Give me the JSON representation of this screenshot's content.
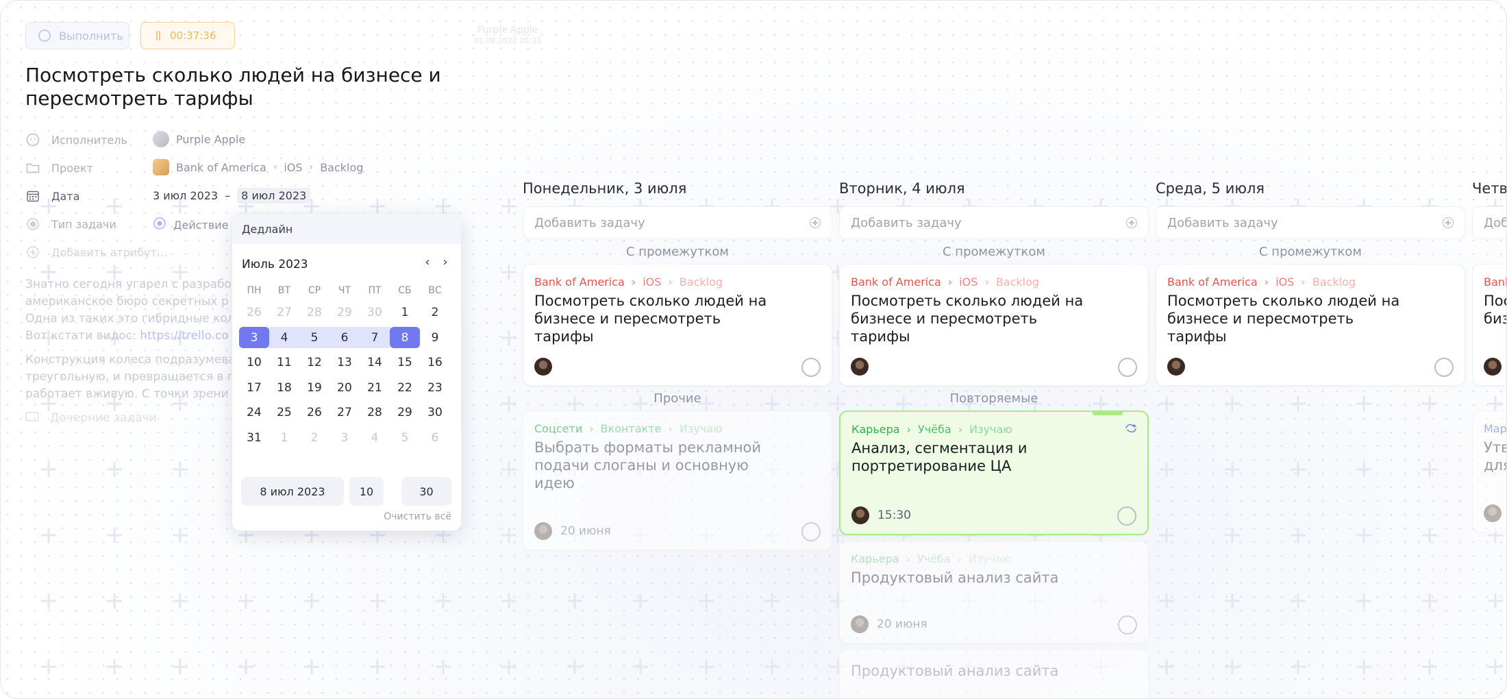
{
  "toolbar": {
    "complete_label": "Выполнить",
    "timer": "00:37:36",
    "owner_name": "Purple Apple",
    "owner_time": "01.08.2022 20:33"
  },
  "task": {
    "title": "Посмотреть сколько людей на бизнесе и пересмотреть тарифы",
    "attributes": {
      "assignee_label": "Исполнитель",
      "assignee_value": "Purple Apple",
      "project_label": "Проект",
      "project_company": "Bank of America",
      "project_platform": "iOS",
      "project_board": "Backlog",
      "date_label": "Дата",
      "date_start": "3 июл 2023",
      "date_sep": "–",
      "date_end": "8 июл 2023",
      "type_label": "Тип задачи",
      "type_value": "Действие",
      "add_attr_label": "Добавить атрибут..."
    },
    "description": {
      "p1": "Знатно сегодня угарел с разрабо",
      "p1b": "американское бюро секретных р",
      "p1c": "Одна из таких это гибридные кол",
      "p1d_prefix": "Вот кстати видос: ",
      "p1d_link": "https://trello.co",
      "p2": "Конструкция колеса подразумева",
      "p2b": "треугольную, и превращается в п",
      "p2c": "работает вживую. С точки зрени",
      "subtasks_label": "Дочерние задачи"
    }
  },
  "date_popup": {
    "header": "Дедлайн",
    "month": "Июль 2023",
    "prev_icon": "chevron-left-icon",
    "next_icon": "chevron-right-icon",
    "weekdays": [
      "ПН",
      "ВТ",
      "СР",
      "ЧТ",
      "ПТ",
      "СБ",
      "ВС"
    ],
    "weeks": [
      [
        {
          "d": "26",
          "m": true
        },
        {
          "d": "27",
          "m": true
        },
        {
          "d": "28",
          "m": true
        },
        {
          "d": "29",
          "m": true
        },
        {
          "d": "30",
          "m": true
        },
        {
          "d": "1"
        },
        {
          "d": "2"
        }
      ],
      [
        {
          "d": "3",
          "sel": true
        },
        {
          "d": "4",
          "r": true
        },
        {
          "d": "5",
          "r": true
        },
        {
          "d": "6",
          "r": true
        },
        {
          "d": "7",
          "r": true
        },
        {
          "d": "8",
          "sel": true
        },
        {
          "d": "9"
        }
      ],
      [
        {
          "d": "10"
        },
        {
          "d": "11"
        },
        {
          "d": "12"
        },
        {
          "d": "13"
        },
        {
          "d": "14"
        },
        {
          "d": "15"
        },
        {
          "d": "16"
        }
      ],
      [
        {
          "d": "17"
        },
        {
          "d": "18"
        },
        {
          "d": "19"
        },
        {
          "d": "20"
        },
        {
          "d": "21"
        },
        {
          "d": "22"
        },
        {
          "d": "23"
        }
      ],
      [
        {
          "d": "24"
        },
        {
          "d": "25"
        },
        {
          "d": "26"
        },
        {
          "d": "27"
        },
        {
          "d": "28"
        },
        {
          "d": "29"
        },
        {
          "d": "30"
        }
      ],
      [
        {
          "d": "31"
        },
        {
          "d": "1",
          "m": true
        },
        {
          "d": "2",
          "m": true
        },
        {
          "d": "3",
          "m": true
        },
        {
          "d": "4",
          "m": true
        },
        {
          "d": "5",
          "m": true
        },
        {
          "d": "6",
          "m": true
        }
      ]
    ],
    "date_field": "8 июл 2023",
    "hour_field": "10",
    "minute_field": "30",
    "clear_label": "Очистить всё"
  },
  "board": {
    "add_task_placeholder": "Добавить задачу",
    "columns": [
      {
        "title": "Понедельник, 3 июля",
        "group1": "С промежутком",
        "card1": {
          "c1": "Bank of America",
          "c2": "iOS",
          "c3": "Backlog",
          "title": "Посмотреть сколько людей на бизнесе и пересмотреть тарифы"
        },
        "group2": "Прочие",
        "card2": {
          "c1": "Соцсети",
          "c2": "Вконтакте",
          "c3": "Изучаю",
          "title": "Выбрать форматы рекламной подачи слоганы и основную идею",
          "date": "20 июня"
        }
      },
      {
        "title": "Вторник, 4 июля",
        "group1": "С промежутком",
        "card1": {
          "c1": "Bank of America",
          "c2": "iOS",
          "c3": "Backlog",
          "title": "Посмотреть сколько людей на бизнесе и пересмотреть тарифы"
        },
        "group2": "Повторяемые",
        "card2": {
          "c1": "Карьера",
          "c2": "Учёба",
          "c3": "Изучаю",
          "title": "Анализ, сегментация и портретирование ЦА",
          "time": "15:30"
        },
        "card3": {
          "c1": "Карьера",
          "c2": "Учёба",
          "c3": "Изучаю",
          "title": "Продуктовый анализ сайта",
          "date": "20 июня"
        },
        "card4": {
          "title": "Продуктовый анализ сайта"
        }
      },
      {
        "title": "Среда, 5 июля",
        "group1": "С промежутком",
        "card1": {
          "c1": "Bank of America",
          "c2": "iOS",
          "c3": "Backlog",
          "title": "Посмотреть сколько людей на бизнесе и пересмотреть тарифы"
        }
      },
      {
        "title": "Четв",
        "add_task_placeholder": "Доб",
        "card1": {
          "c1": "Bank",
          "title1": "Пос",
          "title2": "биз"
        },
        "card2": {
          "c1": "Мар",
          "title1": "Утв",
          "title2": "для"
        }
      }
    ]
  },
  "colors": {
    "accent": "#7278ee",
    "range": "#dfe3fb",
    "danger": "#e6534d",
    "success": "#2bb24c",
    "timer": "#f0b557",
    "repeat_card_bg": "#effbe4",
    "repeat_card_border": "#a9ea84"
  }
}
